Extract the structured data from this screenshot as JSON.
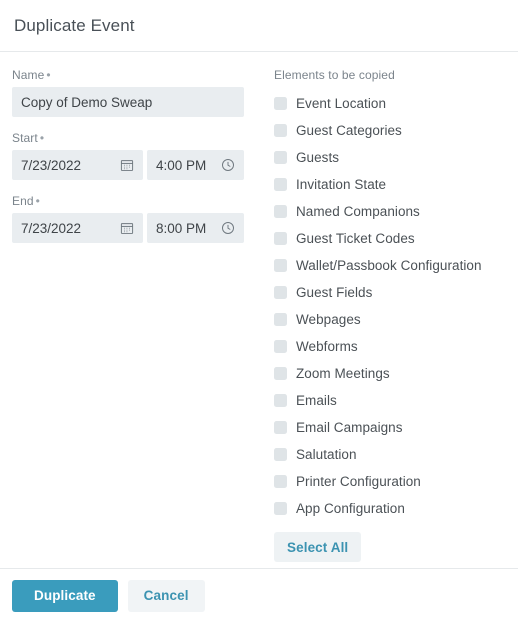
{
  "dialog": {
    "title": "Duplicate Event"
  },
  "form": {
    "name": {
      "label": "Name",
      "required_marker": "•",
      "value": "Copy of Demo Sweap",
      "placeholder": "Name"
    },
    "start": {
      "label": "Start",
      "required_marker": "•",
      "date": "7/23/2022",
      "time": "4:00 PM",
      "date_icon": "calendar-icon",
      "time_icon": "clock-icon"
    },
    "end": {
      "label": "End",
      "required_marker": "•",
      "date": "7/23/2022",
      "time": "8:00 PM",
      "date_icon": "calendar-icon",
      "time_icon": "clock-icon"
    }
  },
  "elements_panel": {
    "heading": "Elements to be copied",
    "select_all_label": "Select All",
    "items": [
      {
        "label": "Event Location",
        "checked": false
      },
      {
        "label": "Guest Categories",
        "checked": false
      },
      {
        "label": "Guests",
        "checked": false
      },
      {
        "label": "Invitation State",
        "checked": false
      },
      {
        "label": "Named Companions",
        "checked": false
      },
      {
        "label": "Guest Ticket Codes",
        "checked": false
      },
      {
        "label": "Wallet/Passbook Configuration",
        "checked": false
      },
      {
        "label": "Guest Fields",
        "checked": false
      },
      {
        "label": "Webpages",
        "checked": false
      },
      {
        "label": "Webforms",
        "checked": false
      },
      {
        "label": "Zoom Meetings",
        "checked": false
      },
      {
        "label": "Emails",
        "checked": false
      },
      {
        "label": "Email Campaigns",
        "checked": false
      },
      {
        "label": "Salutation",
        "checked": false
      },
      {
        "label": "Printer Configuration",
        "checked": false
      },
      {
        "label": "App Configuration",
        "checked": false
      }
    ]
  },
  "footer": {
    "primary_label": "Duplicate",
    "secondary_label": "Cancel"
  },
  "colors": {
    "accent": "#3a9cbd",
    "link_text": "#3c93b1",
    "input_background": "#e9edf0",
    "checkbox": "#dfe4e7",
    "label_text": "#7b848c",
    "body_text": "#4b5156",
    "divider": "#e6e9eb",
    "secondary_button_background": "#f1f4f6"
  }
}
